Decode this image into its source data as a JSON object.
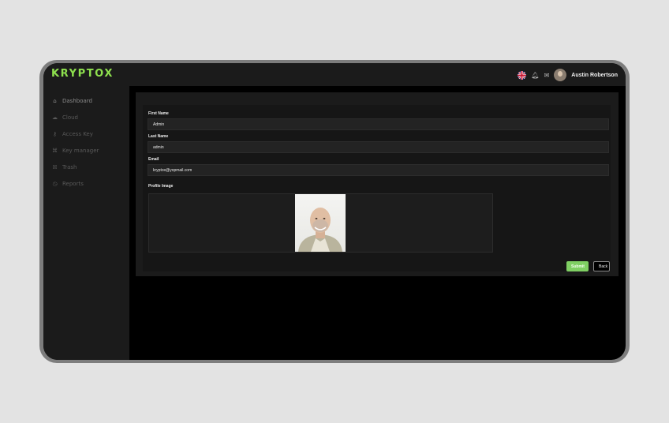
{
  "brand": {
    "logo": "KRYPTOX",
    "accent": "#8ee04e"
  },
  "header": {
    "user_name": "Austin Robertson",
    "flag_icon": "uk-flag-icon",
    "notification_icon": "bell-icon",
    "mail_icon": "mail-icon"
  },
  "sidebar": {
    "items": [
      {
        "label": "Dashboard",
        "icon": "home-icon"
      },
      {
        "label": "Cloud",
        "icon": "cloud-icon"
      },
      {
        "label": "Access Key",
        "icon": "key-icon"
      },
      {
        "label": "Key manager",
        "icon": "key-manager-icon"
      },
      {
        "label": "Trash",
        "icon": "trash-icon"
      },
      {
        "label": "Reports",
        "icon": "reports-icon"
      }
    ]
  },
  "form": {
    "first_name": {
      "label": "First Name",
      "value": "Admin"
    },
    "last_name": {
      "label": "Last Name",
      "value": "admin"
    },
    "email": {
      "label": "Email",
      "value": "kryptox@yopmail.com"
    },
    "profile_image": {
      "label": "Profile Image"
    },
    "submit_label": "Submit",
    "back_label": "Back",
    "submit_color": "#7fcf63"
  }
}
